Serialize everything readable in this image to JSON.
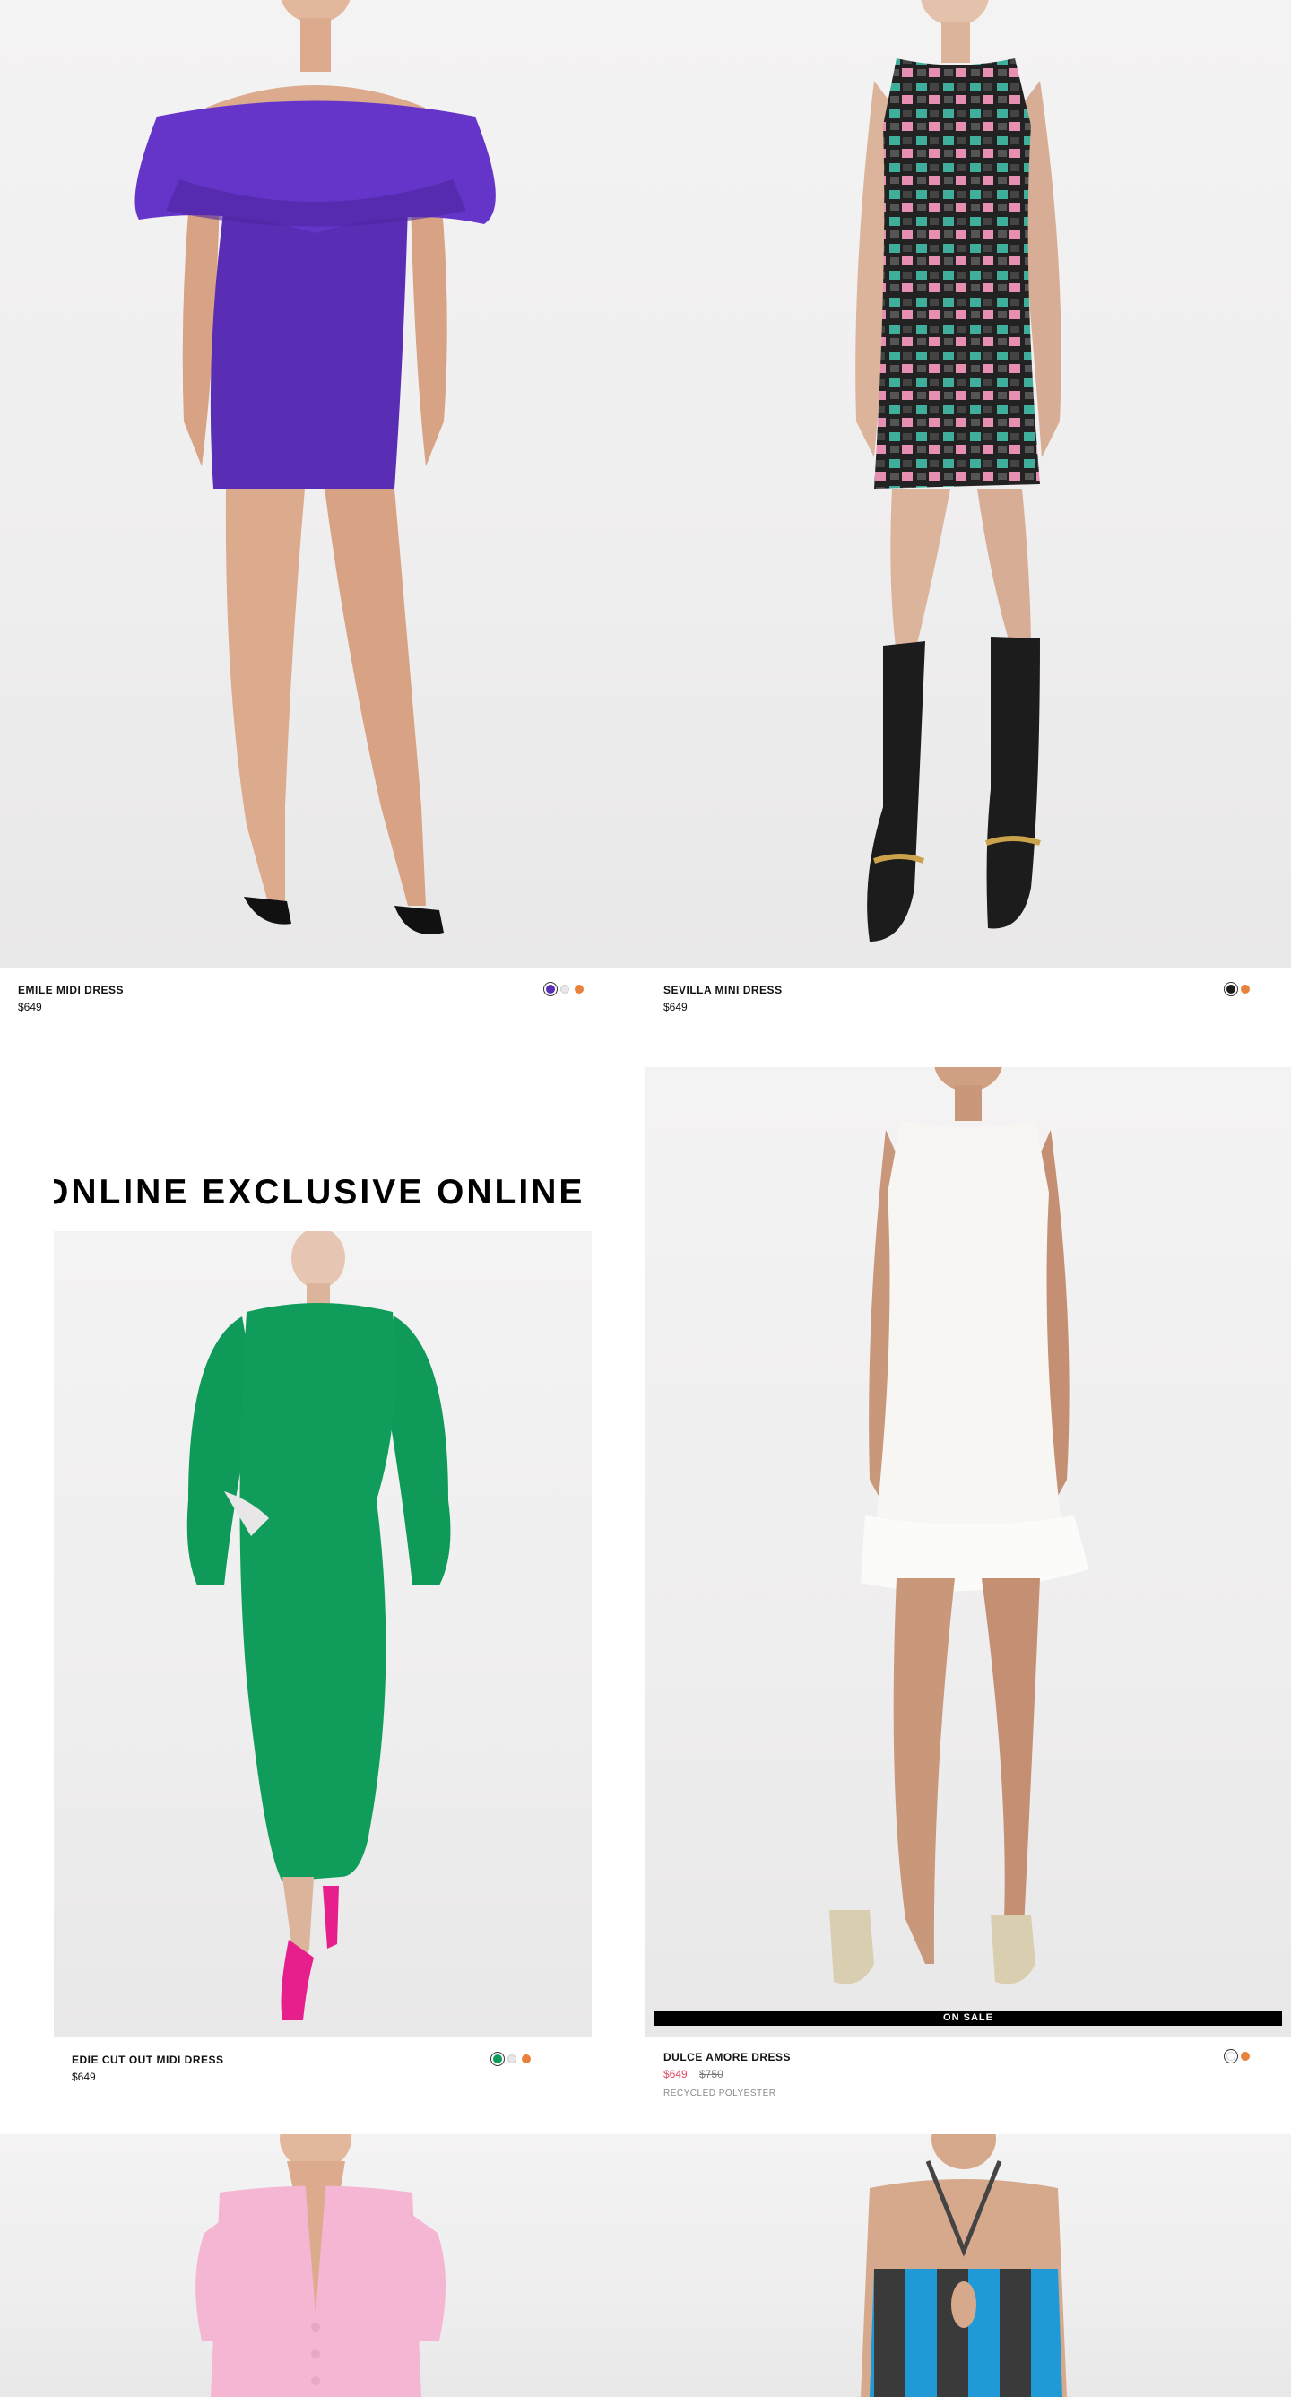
{
  "products": [
    {
      "name": "EMILE MIDI DRESS",
      "price": "$649",
      "swatch_colors": [
        "#5a2db5",
        "#e8e6e6",
        "#e8813b"
      ],
      "selected_swatch": 0
    },
    {
      "name": "SEVILLA MINI DRESS",
      "price": "$649",
      "swatch_colors": [
        "#1c1c1c",
        "#e8813b"
      ],
      "selected_swatch": 0
    },
    {
      "name": "EDIE CUT OUT MIDI DRESS",
      "price": "$649",
      "ticker_text": "ONLINE EXCLUSIVE ONLINE EXCLUSIVE",
      "swatch_colors": [
        "#0f9a5a",
        "#e8e6e6",
        "#e8813b"
      ],
      "selected_swatch": 0
    },
    {
      "name": "DULCE AMORE DRESS",
      "sale_price": "$649",
      "original_price": "$750",
      "badge": "ON SALE",
      "material": "RECYCLED POLYESTER",
      "swatch_colors": [
        "#ffffff",
        "#e8813b"
      ],
      "selected_swatch": 0
    }
  ],
  "colors": {
    "sale": "#e24b63",
    "purple_dress": "#5a2db5",
    "green_dress": "#0f9a5a",
    "pink_top": "#f4b6d3",
    "blue_stripe": "#1f9ad6"
  }
}
